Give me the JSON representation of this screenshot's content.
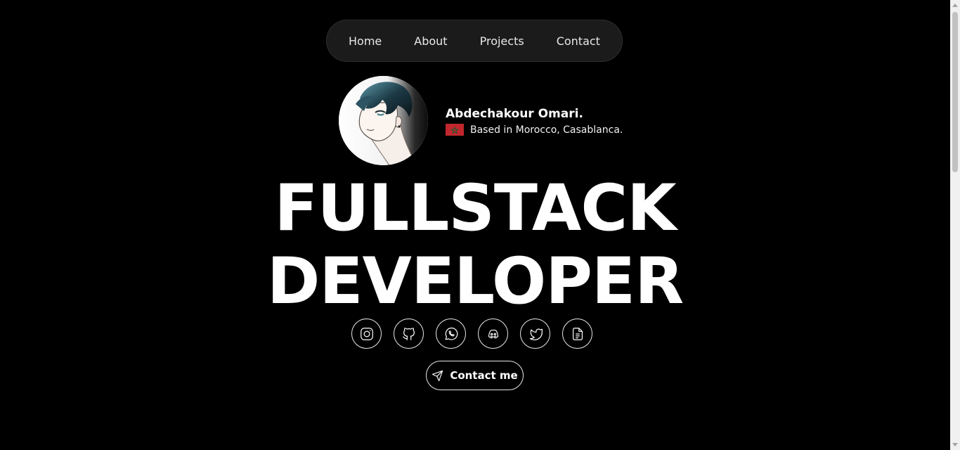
{
  "nav": {
    "items": [
      {
        "label": "Home"
      },
      {
        "label": "About"
      },
      {
        "label": "Projects"
      },
      {
        "label": "Contact"
      }
    ]
  },
  "profile": {
    "name": "Abdechakour Omari.",
    "location": "Based in Morocco, Casablanca.",
    "flag_icon": "morocco-flag-icon"
  },
  "hero": {
    "line1": "FULLSTACK",
    "line2": "DEVELOPER"
  },
  "socials": [
    {
      "icon": "instagram-icon"
    },
    {
      "icon": "github-icon"
    },
    {
      "icon": "whatsapp-icon"
    },
    {
      "icon": "discord-icon"
    },
    {
      "icon": "twitter-icon"
    },
    {
      "icon": "document-icon"
    }
  ],
  "cta": {
    "label": "Contact me",
    "icon": "send-icon"
  },
  "colors": {
    "background": "#000000",
    "nav_background": "#1b1b1b",
    "text": "#ffffff",
    "flag_red": "#c1272d",
    "flag_green": "#006233"
  }
}
